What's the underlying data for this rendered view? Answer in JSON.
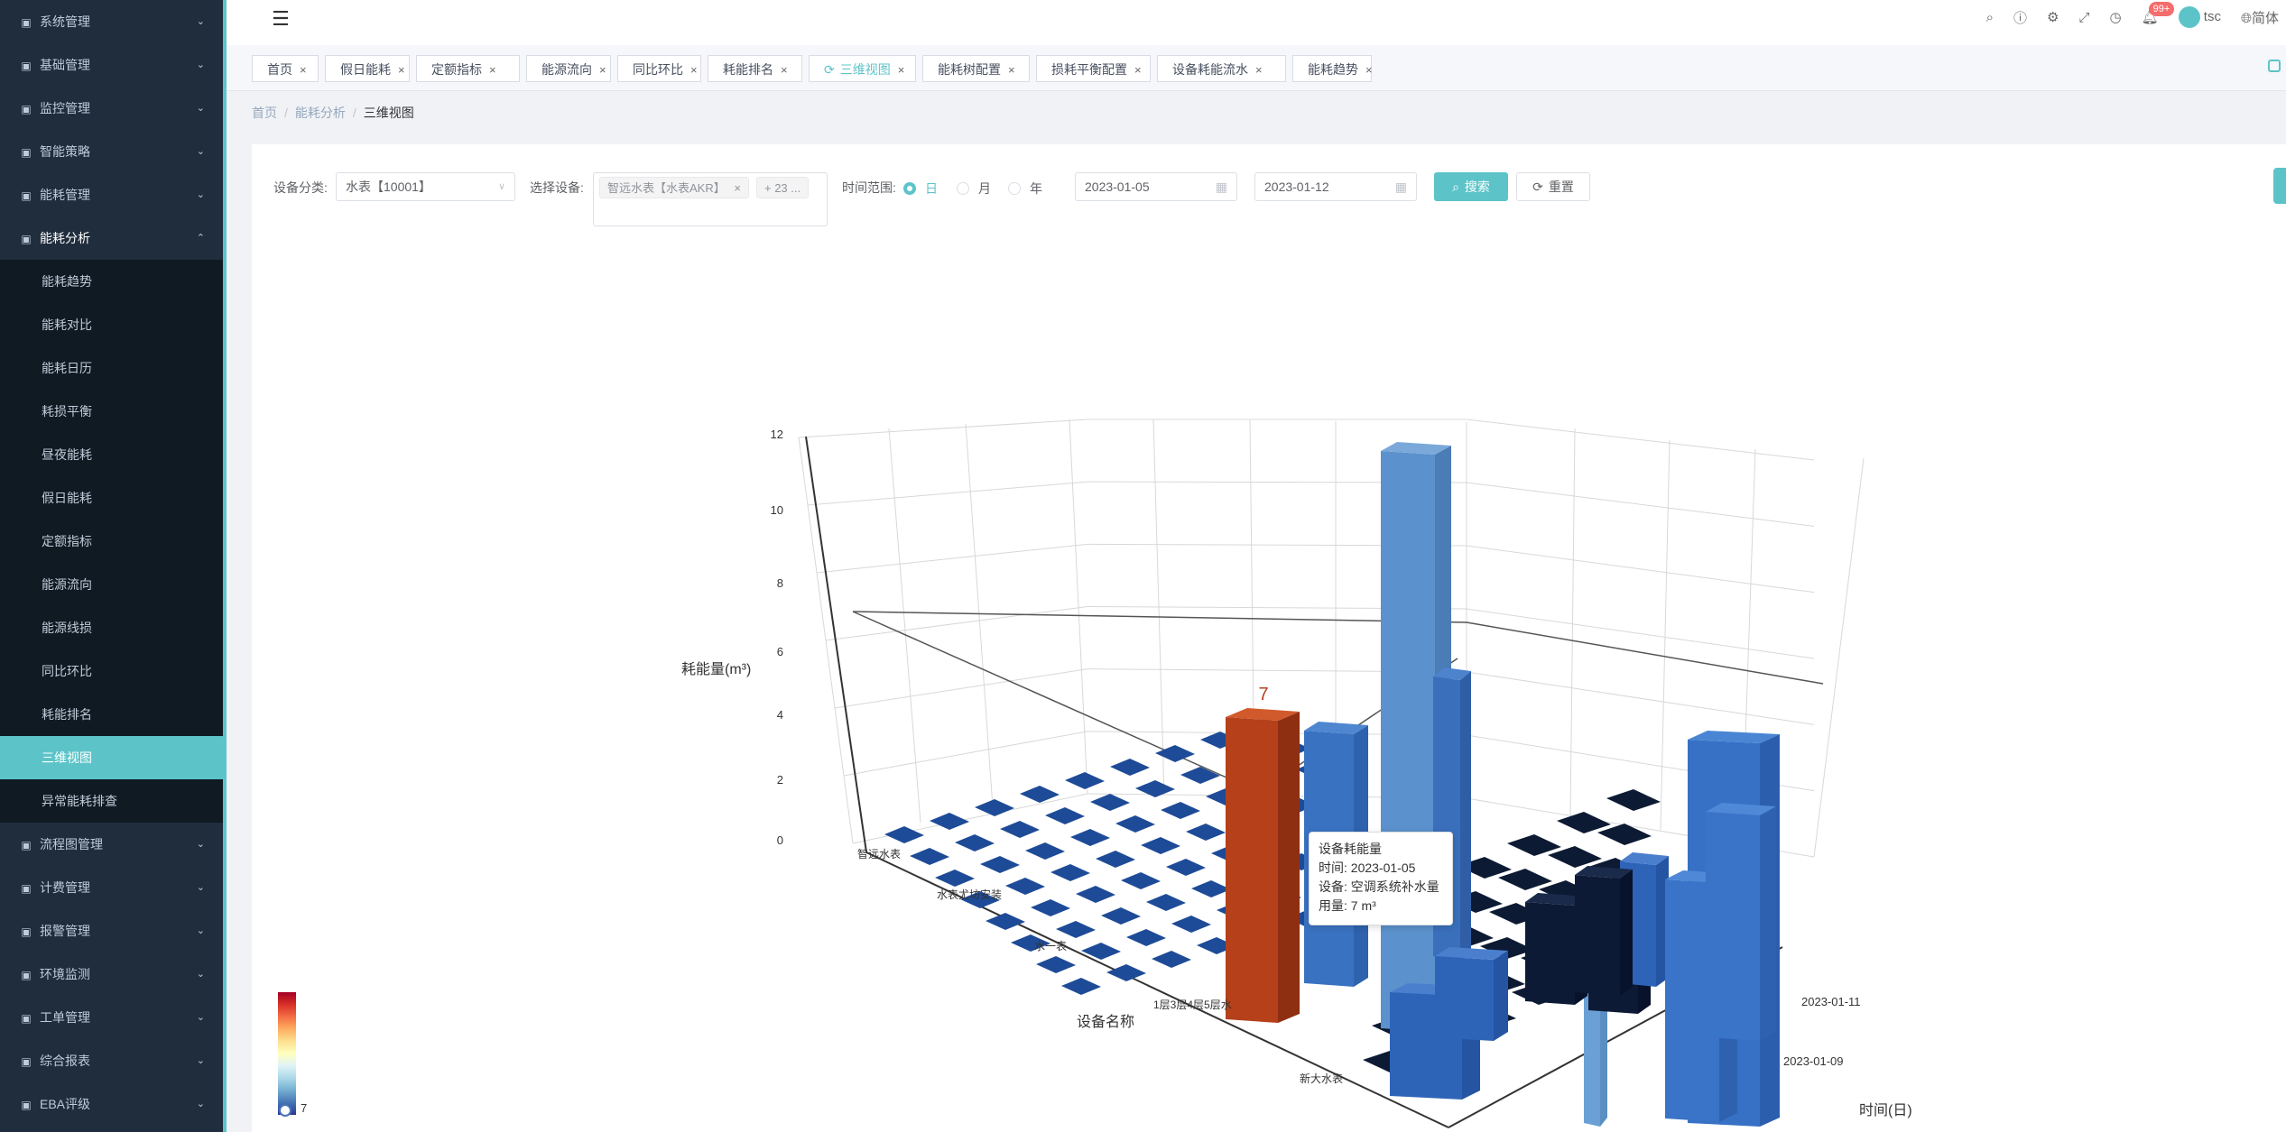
{
  "sidebar": {
    "menus_top": [
      {
        "label": "系统管理",
        "icon": "monitor-icon"
      },
      {
        "label": "基础管理",
        "icon": "grid-icon"
      },
      {
        "label": "监控管理",
        "icon": "camera-icon"
      },
      {
        "label": "智能策略",
        "icon": "bulb-icon"
      },
      {
        "label": "能耗管理",
        "icon": "list-icon"
      },
      {
        "label": "能耗分析",
        "icon": "chart-icon"
      }
    ],
    "submenu": [
      "能耗趋势",
      "能耗对比",
      "能耗日历",
      "耗损平衡",
      "昼夜能耗",
      "假日能耗",
      "定额指标",
      "能源流向",
      "能源线损",
      "同比环比",
      "耗能排名",
      "三维视图",
      "异常能耗排查"
    ],
    "active_submenu": "三维视图",
    "menus_bottom": [
      {
        "label": "流程图管理",
        "icon": "flow-icon"
      },
      {
        "label": "计费管理",
        "icon": "billing-icon"
      },
      {
        "label": "报警管理",
        "icon": "alarm-icon"
      },
      {
        "label": "环境监测",
        "icon": "leaf-icon"
      },
      {
        "label": "工单管理",
        "icon": "gear-icon"
      },
      {
        "label": "综合报表",
        "icon": "report-icon"
      },
      {
        "label": "EBA评级",
        "icon": "rating-icon"
      }
    ]
  },
  "header": {
    "notification_count": "99+",
    "username": "tsc",
    "language": "简体",
    "accent_color": "#5cc4c9"
  },
  "tabs": [
    "首页",
    "假日能耗",
    "定额指标",
    "能源流向",
    "同比环比",
    "耗能排名",
    "三维视图",
    "能耗树配置",
    "损耗平衡配置",
    "设备耗能流水",
    "能耗趋势"
  ],
  "active_tab": "三维视图",
  "breadcrumb": [
    "首页",
    "能耗分析",
    "三维视图"
  ],
  "filters": {
    "category_label": "设备分类:",
    "category_value": "水表【10001】",
    "device_label": "选择设备:",
    "device_chip": "智远水表【水表AKR】",
    "device_more": "+ 23 ...",
    "time_label": "时间范围:",
    "time_options": [
      "日",
      "月",
      "年"
    ],
    "time_selected": "日",
    "start_date": "2023-01-05",
    "end_date": "2023-01-12",
    "search_label": "搜索",
    "reset_label": "重置"
  },
  "chart": {
    "ylabel": "耗能量(m³)",
    "xlabel": "设备名称",
    "zlabel": "时间(日)",
    "y_ticks": [
      "0",
      "2",
      "4",
      "6",
      "8",
      "10",
      "12"
    ],
    "device_labels_visible": [
      "智远水表",
      "水表尤坊安装",
      "水一表",
      "1层3层4层5层水",
      "新大水表"
    ],
    "date_labels_visible": [
      "2023-01-09",
      "2023-01-11"
    ],
    "highlight_value": "7",
    "visualmap_max": "7"
  },
  "chart_data": {
    "type": "bar3d",
    "title": "",
    "xlabel": "设备名称",
    "ylabel": "耗能量(m³)",
    "zlabel": "时间(日)",
    "ylim": [
      0,
      12
    ],
    "highlight": {
      "date": "2023-01-05",
      "device": "空调系统补水量",
      "value": 7
    },
    "approx_tall_bars": [
      {
        "device": "空调系统补水量",
        "date": "2023-01-05",
        "value": 7
      },
      {
        "device": "unknown",
        "date": "2023-01-05",
        "value": 6
      },
      {
        "device": "unknown",
        "date": "2023-01-06",
        "value": 12
      },
      {
        "device": "unknown",
        "date": "2023-01-11",
        "value": 8
      },
      {
        "device": "unknown",
        "date": "2023-01-11",
        "value": 7
      }
    ]
  },
  "tooltip": {
    "title": "设备耗能量",
    "time": "时间: 2023-01-05",
    "device": "设备: 空调系统补水量",
    "usage": "用量: 7 m³"
  }
}
